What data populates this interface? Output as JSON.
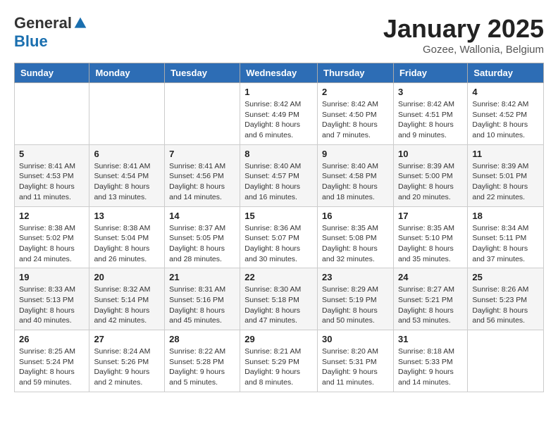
{
  "header": {
    "logo_general": "General",
    "logo_blue": "Blue",
    "month_title": "January 2025",
    "location": "Gozee, Wallonia, Belgium"
  },
  "weekdays": [
    "Sunday",
    "Monday",
    "Tuesday",
    "Wednesday",
    "Thursday",
    "Friday",
    "Saturday"
  ],
  "weeks": [
    [
      {
        "day": "",
        "info": ""
      },
      {
        "day": "",
        "info": ""
      },
      {
        "day": "",
        "info": ""
      },
      {
        "day": "1",
        "info": "Sunrise: 8:42 AM\nSunset: 4:49 PM\nDaylight: 8 hours and 6 minutes."
      },
      {
        "day": "2",
        "info": "Sunrise: 8:42 AM\nSunset: 4:50 PM\nDaylight: 8 hours and 7 minutes."
      },
      {
        "day": "3",
        "info": "Sunrise: 8:42 AM\nSunset: 4:51 PM\nDaylight: 8 hours and 9 minutes."
      },
      {
        "day": "4",
        "info": "Sunrise: 8:42 AM\nSunset: 4:52 PM\nDaylight: 8 hours and 10 minutes."
      }
    ],
    [
      {
        "day": "5",
        "info": "Sunrise: 8:41 AM\nSunset: 4:53 PM\nDaylight: 8 hours and 11 minutes."
      },
      {
        "day": "6",
        "info": "Sunrise: 8:41 AM\nSunset: 4:54 PM\nDaylight: 8 hours and 13 minutes."
      },
      {
        "day": "7",
        "info": "Sunrise: 8:41 AM\nSunset: 4:56 PM\nDaylight: 8 hours and 14 minutes."
      },
      {
        "day": "8",
        "info": "Sunrise: 8:40 AM\nSunset: 4:57 PM\nDaylight: 8 hours and 16 minutes."
      },
      {
        "day": "9",
        "info": "Sunrise: 8:40 AM\nSunset: 4:58 PM\nDaylight: 8 hours and 18 minutes."
      },
      {
        "day": "10",
        "info": "Sunrise: 8:39 AM\nSunset: 5:00 PM\nDaylight: 8 hours and 20 minutes."
      },
      {
        "day": "11",
        "info": "Sunrise: 8:39 AM\nSunset: 5:01 PM\nDaylight: 8 hours and 22 minutes."
      }
    ],
    [
      {
        "day": "12",
        "info": "Sunrise: 8:38 AM\nSunset: 5:02 PM\nDaylight: 8 hours and 24 minutes."
      },
      {
        "day": "13",
        "info": "Sunrise: 8:38 AM\nSunset: 5:04 PM\nDaylight: 8 hours and 26 minutes."
      },
      {
        "day": "14",
        "info": "Sunrise: 8:37 AM\nSunset: 5:05 PM\nDaylight: 8 hours and 28 minutes."
      },
      {
        "day": "15",
        "info": "Sunrise: 8:36 AM\nSunset: 5:07 PM\nDaylight: 8 hours and 30 minutes."
      },
      {
        "day": "16",
        "info": "Sunrise: 8:35 AM\nSunset: 5:08 PM\nDaylight: 8 hours and 32 minutes."
      },
      {
        "day": "17",
        "info": "Sunrise: 8:35 AM\nSunset: 5:10 PM\nDaylight: 8 hours and 35 minutes."
      },
      {
        "day": "18",
        "info": "Sunrise: 8:34 AM\nSunset: 5:11 PM\nDaylight: 8 hours and 37 minutes."
      }
    ],
    [
      {
        "day": "19",
        "info": "Sunrise: 8:33 AM\nSunset: 5:13 PM\nDaylight: 8 hours and 40 minutes."
      },
      {
        "day": "20",
        "info": "Sunrise: 8:32 AM\nSunset: 5:14 PM\nDaylight: 8 hours and 42 minutes."
      },
      {
        "day": "21",
        "info": "Sunrise: 8:31 AM\nSunset: 5:16 PM\nDaylight: 8 hours and 45 minutes."
      },
      {
        "day": "22",
        "info": "Sunrise: 8:30 AM\nSunset: 5:18 PM\nDaylight: 8 hours and 47 minutes."
      },
      {
        "day": "23",
        "info": "Sunrise: 8:29 AM\nSunset: 5:19 PM\nDaylight: 8 hours and 50 minutes."
      },
      {
        "day": "24",
        "info": "Sunrise: 8:27 AM\nSunset: 5:21 PM\nDaylight: 8 hours and 53 minutes."
      },
      {
        "day": "25",
        "info": "Sunrise: 8:26 AM\nSunset: 5:23 PM\nDaylight: 8 hours and 56 minutes."
      }
    ],
    [
      {
        "day": "26",
        "info": "Sunrise: 8:25 AM\nSunset: 5:24 PM\nDaylight: 8 hours and 59 minutes."
      },
      {
        "day": "27",
        "info": "Sunrise: 8:24 AM\nSunset: 5:26 PM\nDaylight: 9 hours and 2 minutes."
      },
      {
        "day": "28",
        "info": "Sunrise: 8:22 AM\nSunset: 5:28 PM\nDaylight: 9 hours and 5 minutes."
      },
      {
        "day": "29",
        "info": "Sunrise: 8:21 AM\nSunset: 5:29 PM\nDaylight: 9 hours and 8 minutes."
      },
      {
        "day": "30",
        "info": "Sunrise: 8:20 AM\nSunset: 5:31 PM\nDaylight: 9 hours and 11 minutes."
      },
      {
        "day": "31",
        "info": "Sunrise: 8:18 AM\nSunset: 5:33 PM\nDaylight: 9 hours and 14 minutes."
      },
      {
        "day": "",
        "info": ""
      }
    ]
  ]
}
